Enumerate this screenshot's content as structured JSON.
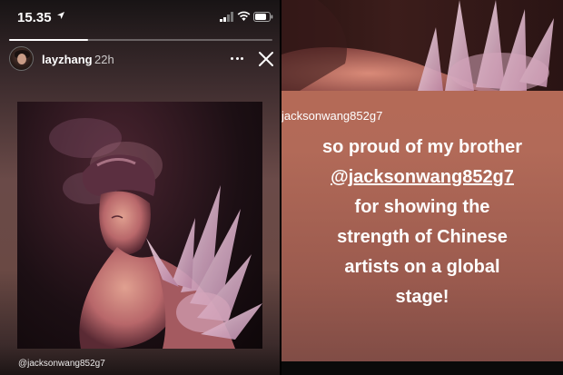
{
  "status_bar": {
    "time": "15.35"
  },
  "story": {
    "progress": 0.3,
    "username": "layzhang",
    "age": "22h",
    "mention": "@jacksonwang852g7"
  },
  "repost": {
    "mention": "jacksonwang852g7",
    "caption_line1": "so proud of my brother",
    "caption_link": "@jacksonwang852g7",
    "caption_line3": "for showing the",
    "caption_line4": "strength of Chinese",
    "caption_line5": "artists on a global",
    "caption_line6": "stage!"
  }
}
